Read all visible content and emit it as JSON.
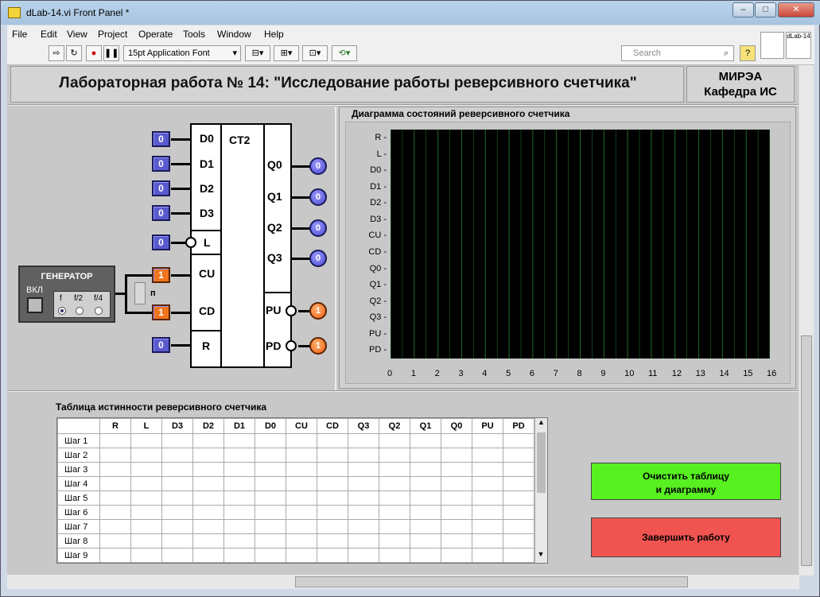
{
  "window": {
    "title": "dLab-14.vi Front Panel *",
    "min": "–",
    "max": "□",
    "close": "✕"
  },
  "menu": [
    "File",
    "Edit",
    "View",
    "Project",
    "Operate",
    "Tools",
    "Window",
    "Help"
  ],
  "toolbar": {
    "font": "15pt Application Font",
    "search_placeholder": "Search",
    "help": "?",
    "vi_icon": "dLab-14"
  },
  "header": {
    "title": "Лабораторная работа № 14: \"Исследование работы реверсивного счетчика\"",
    "org_line1": "МИРЭА",
    "org_line2": "Кафедра ИС"
  },
  "counter": {
    "name": "CT2",
    "inputs": [
      {
        "pin": "D0",
        "value": "0"
      },
      {
        "pin": "D1",
        "value": "0"
      },
      {
        "pin": "D2",
        "value": "0"
      },
      {
        "pin": "D3",
        "value": "0"
      },
      {
        "pin": "L",
        "value": "0"
      },
      {
        "pin": "CU",
        "value": "1"
      },
      {
        "pin": "CD",
        "value": "1"
      },
      {
        "pin": "R",
        "value": "0"
      }
    ],
    "outputs": [
      {
        "pin": "Q0",
        "value": "0"
      },
      {
        "pin": "Q1",
        "value": "0"
      },
      {
        "pin": "Q2",
        "value": "0"
      },
      {
        "pin": "Q3",
        "value": "0"
      },
      {
        "pin": "PU",
        "value": "1"
      },
      {
        "pin": "PD",
        "value": "1"
      }
    ],
    "switch_label": "п"
  },
  "generator": {
    "title": "ГЕНЕРАТОР",
    "on_label": "ВКЛ",
    "freqs": [
      "f",
      "f/2",
      "f/4"
    ],
    "selected": 0
  },
  "chart": {
    "title": "Диаграмма состояний реверсивного счетчика"
  },
  "chart_data": {
    "type": "line",
    "title": "Диаграмма состояний реверсивного счетчика",
    "y_categories": [
      "R",
      "L",
      "D0",
      "D1",
      "D2",
      "D3",
      "CU",
      "CD",
      "Q0",
      "Q1",
      "Q2",
      "Q3",
      "PU",
      "PD"
    ],
    "x_ticks": [
      0,
      1,
      2,
      3,
      4,
      5,
      6,
      7,
      8,
      9,
      10,
      11,
      12,
      13,
      14,
      15,
      16
    ],
    "xlim": [
      0,
      16
    ],
    "grid": true,
    "series": []
  },
  "table": {
    "title": "Таблица истинности реверсивного счетчика",
    "columns": [
      "R",
      "L",
      "D3",
      "D2",
      "D1",
      "D0",
      "CU",
      "CD",
      "Q3",
      "Q2",
      "Q1",
      "Q0",
      "PU",
      "PD"
    ],
    "rows": [
      "Шаг 1",
      "Шаг 2",
      "Шаг 3",
      "Шаг 4",
      "Шаг 5",
      "Шаг 6",
      "Шаг 7",
      "Шаг 8",
      "Шаг 9"
    ]
  },
  "buttons": {
    "clear_line1": "Очистить таблицу",
    "clear_line2": "и диаграмму",
    "finish": "Завершить работу"
  },
  "colors": {
    "clear": "#58f020",
    "finish": "#f05450",
    "control": "#5a5acf",
    "active": "#f0741d",
    "plot_bg": "#000000",
    "grid": "#1f6a2a"
  }
}
